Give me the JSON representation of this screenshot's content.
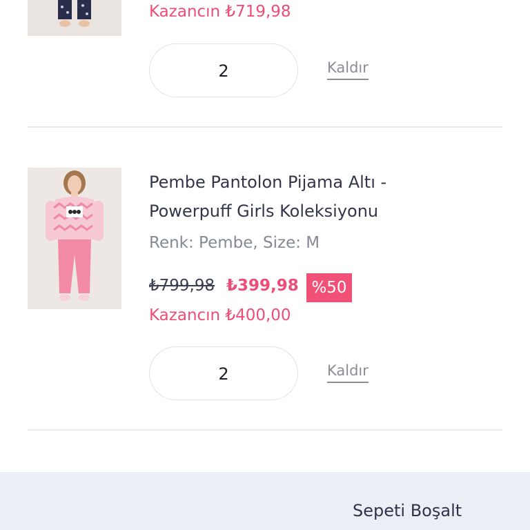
{
  "items": [
    {
      "savings": "Kazancın ₺719,98",
      "quantity": "2",
      "remove_label": "Kaldır"
    },
    {
      "title_line1": "Pembe Pantolon Pijama Altı -",
      "title_line2": "Powerpuff Girls Koleksiyonu",
      "variant": "Renk: Pembe, Size: M",
      "old_price": "₺799,98",
      "new_price": "₺399,98",
      "discount": "%50",
      "savings": "Kazancın ₺400,00",
      "quantity": "2",
      "remove_label": "Kaldır"
    }
  ],
  "footer": {
    "clear_cart_label": "Sepeti Boşalt"
  },
  "colors": {
    "accent_pink": "#ee4d75",
    "badge_bg": "#f15177",
    "footer_bg": "#eceef5",
    "text_dark": "#33364b",
    "text_muted": "#858896"
  }
}
